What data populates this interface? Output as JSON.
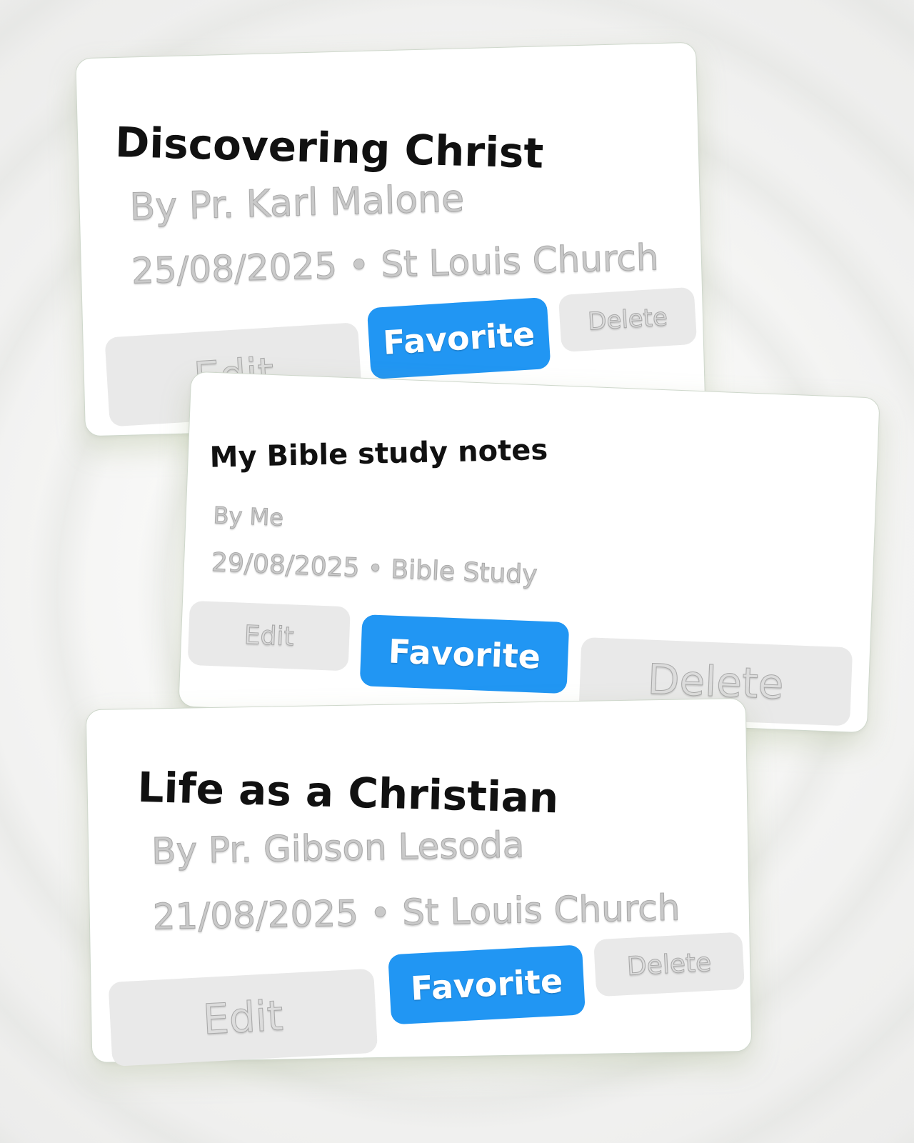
{
  "colors": {
    "favorite_blue": "#2196f3",
    "button_gray": "#e9e9e9",
    "title_text": "#111111",
    "meta_text": "#c9c9c9",
    "card_border": "#cfd8cc"
  },
  "sermons": [
    {
      "title": "Discovering Christ",
      "author": "By Pr. Karl Malone",
      "date_location": "25/08/2025 • St Louis Church",
      "edit_label": "Edit",
      "favorite_label": "Favorite",
      "delete_label": "Delete"
    },
    {
      "title": "My Bible study notes",
      "author": "By Me",
      "date_location": "29/08/2025 • Bible Study",
      "edit_label": "Edit",
      "favorite_label": "Favorite",
      "delete_label": "Delete"
    },
    {
      "title": "Life as a Christian",
      "author": "By Pr. Gibson Lesoda",
      "date_location": "21/08/2025 • St Louis Church",
      "edit_label": "Edit",
      "favorite_label": "Favorite",
      "delete_label": "Delete"
    }
  ]
}
